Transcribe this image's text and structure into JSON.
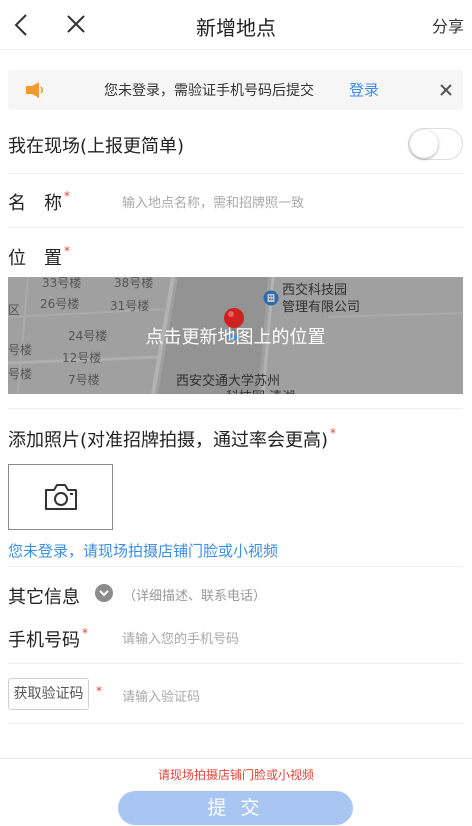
{
  "nav": {
    "title": "新增地点",
    "share_label": "分享"
  },
  "banner": {
    "text": "您未登录，需验证手机号码后提交",
    "login_label": "登录"
  },
  "on_site": {
    "label": "我在现场(上报更简单)",
    "enabled": false
  },
  "name_field": {
    "label": "名　称",
    "required_mark": "*",
    "placeholder": "输入地点名称，需和招牌照一致"
  },
  "location_field": {
    "label": "位　置",
    "required_mark": "*"
  },
  "map": {
    "cta": "点击更新地图上的位置",
    "building_labels": [
      "33号楼",
      "38号楼",
      "26号楼",
      "31号楼",
      "区",
      "24号楼",
      "号楼",
      "12号楼",
      "号楼",
      "7号楼"
    ],
    "poi_top": [
      "西交科技园",
      "管理有限公司"
    ],
    "poi_bottom": [
      "西安交通大学苏州",
      "科技园  清湖"
    ],
    "pin_color": "#d0201f",
    "poi_color": "#3b8ad9"
  },
  "photo": {
    "label": "添加照片(对准招牌拍摄，通过率会更高)",
    "required_mark": "*",
    "hint": "您未登录，请现场拍摄店铺门脸或小视频"
  },
  "other_info": {
    "label": "其它信息",
    "hint": "（详细描述、联系电话）"
  },
  "phone": {
    "label": "手机号码",
    "required_mark": "*",
    "placeholder": "请输入您的手机号码"
  },
  "verify": {
    "button_label": "获取验证码",
    "required_mark": "*",
    "placeholder": "请输入验证码"
  },
  "footer": {
    "hint": "请现场拍摄店铺门脸或小视频",
    "submit_label": "提 交"
  },
  "colors": {
    "accent": "#3a8ee6",
    "required": "#e0463a",
    "submit_disabled": "#a9c6f2",
    "banner_icon": "#f29a2e"
  }
}
